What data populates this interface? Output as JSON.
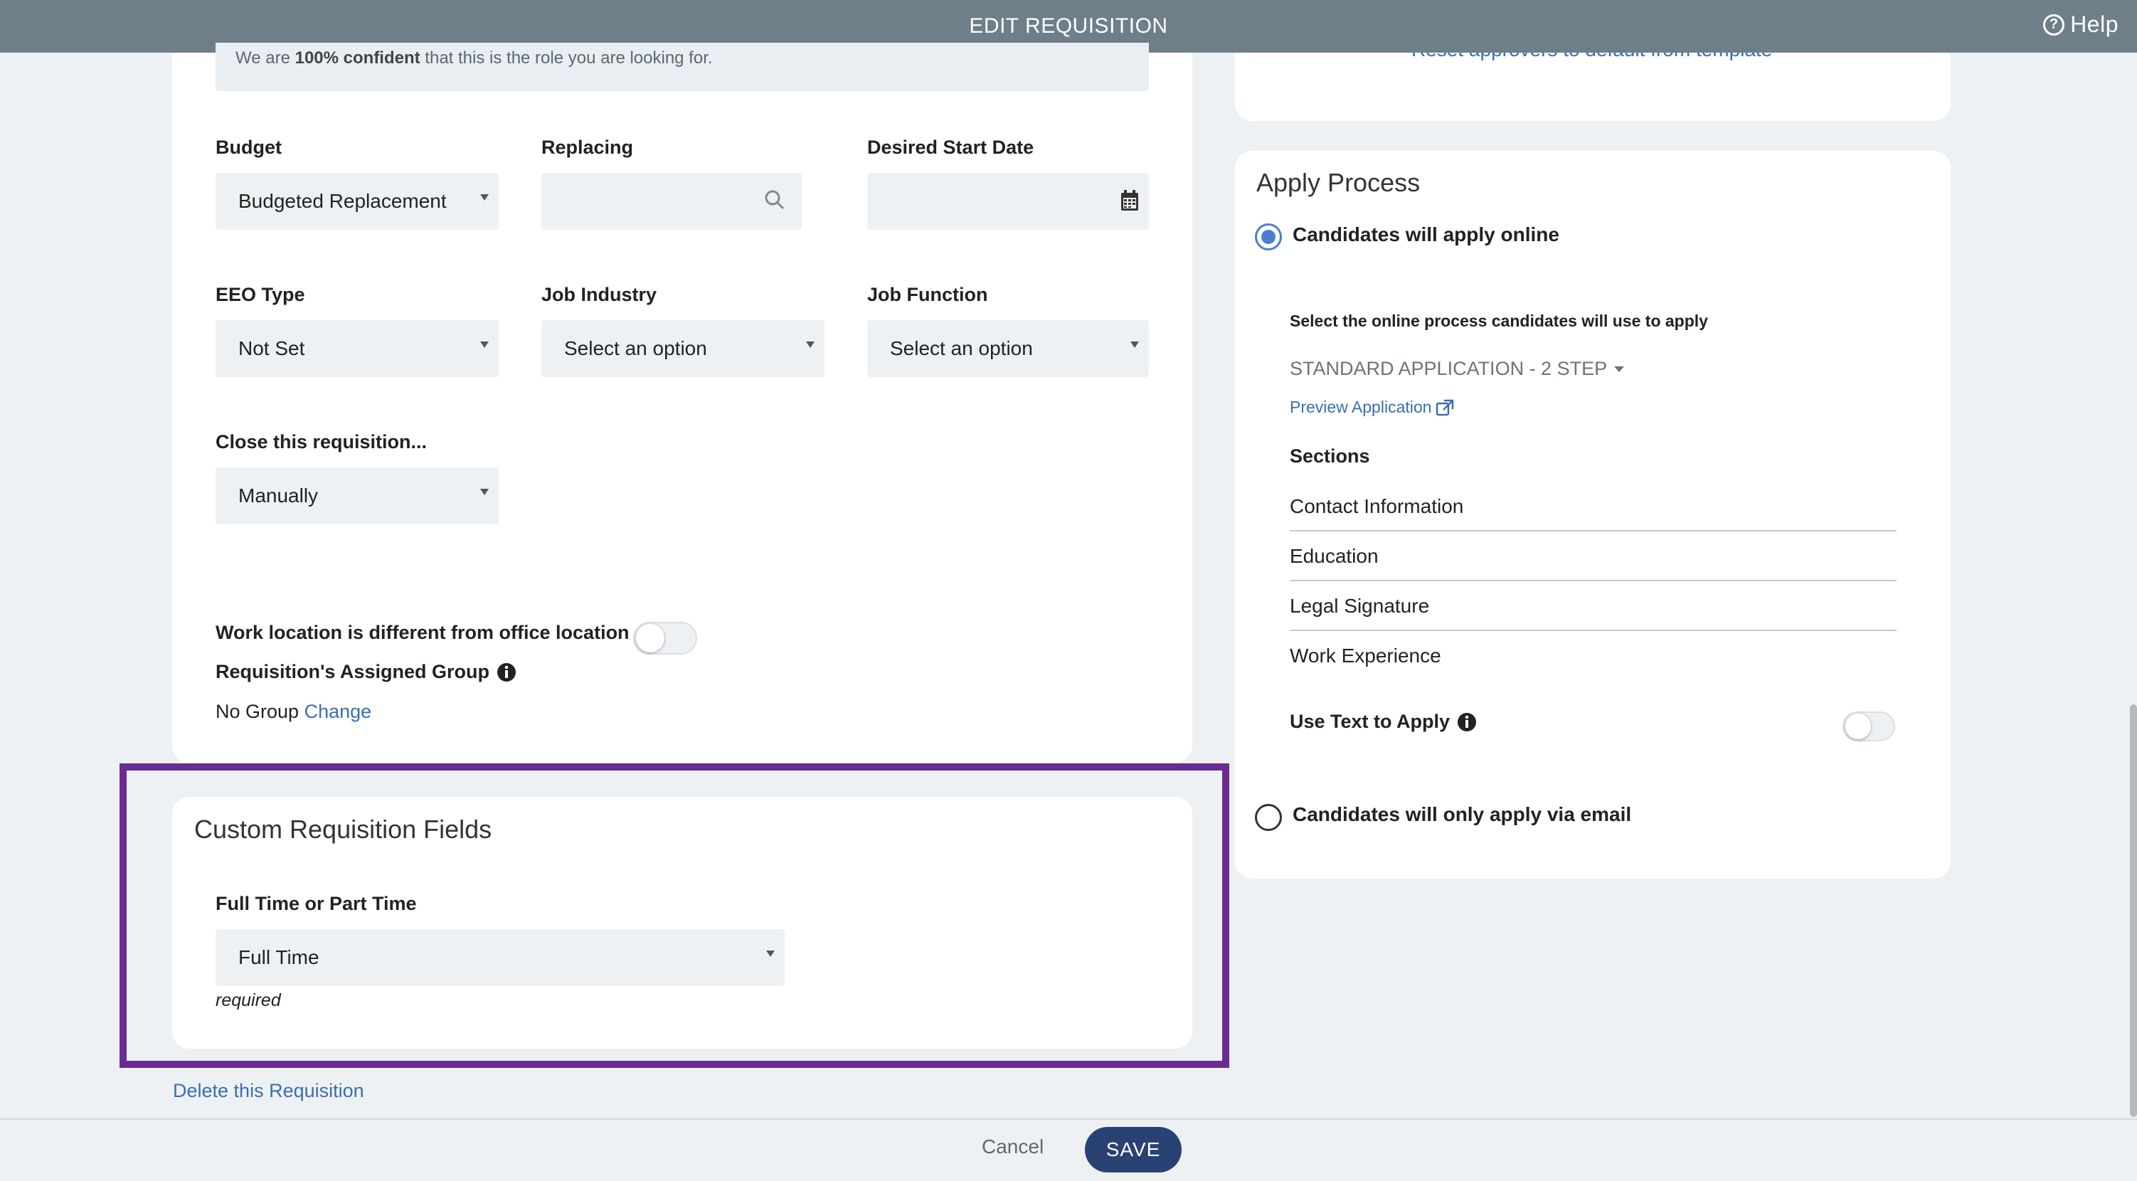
{
  "header": {
    "title": "EDIT REQUISITION",
    "help_label": "Help",
    "help_icon": "question-circle-icon"
  },
  "banner": {
    "prefix": "We are ",
    "bold": "100% confident",
    "suffix": " that this is the role you are looking for."
  },
  "fields": {
    "budget": {
      "label": "Budget",
      "value": "Budgeted Replacement"
    },
    "replacing": {
      "label": "Replacing",
      "value": ""
    },
    "desired_start_date": {
      "label": "Desired Start Date",
      "value": ""
    },
    "eeo_type": {
      "label": "EEO Type",
      "value": "Not Set"
    },
    "job_industry": {
      "label": "Job Industry",
      "value": "Select an option"
    },
    "job_function": {
      "label": "Job Function",
      "value": "Select an option"
    },
    "close_requisition": {
      "label": "Close this requisition...",
      "value": "Manually"
    }
  },
  "work_location": {
    "label": "Work location is different from office location",
    "enabled": false
  },
  "assigned_group": {
    "label": "Requisition's Assigned Group",
    "value": "No Group",
    "change_link": "Change"
  },
  "custom_fields": {
    "title": "Custom Requisition Fields",
    "field_label": "Full Time or Part Time",
    "field_value": "Full Time",
    "required_note": "required"
  },
  "delete_link": "Delete this Requisition",
  "approvers_card": {
    "reset_link": "Reset approvers to default from template"
  },
  "apply_process": {
    "title": "Apply Process",
    "online_option": "Candidates will apply online",
    "online_selected": true,
    "select_process_label": "Select the online process candidates will use to apply",
    "process_value": "STANDARD APPLICATION - 2 STEP",
    "preview_link": "Preview Application",
    "sections_label": "Sections",
    "sections": [
      "Contact Information",
      "Education",
      "Legal Signature",
      "Work Experience"
    ],
    "text_to_apply_label": "Use Text to Apply",
    "text_to_apply_enabled": false,
    "email_option": "Candidates will only apply via email"
  },
  "footer": {
    "cancel_label": "Cancel",
    "save_label": "SAVE"
  },
  "colors": {
    "accent": "#3a6fb0",
    "highlight": "#6a2b93",
    "save_button": "#2a4173",
    "topbar": "#6f7f89"
  }
}
